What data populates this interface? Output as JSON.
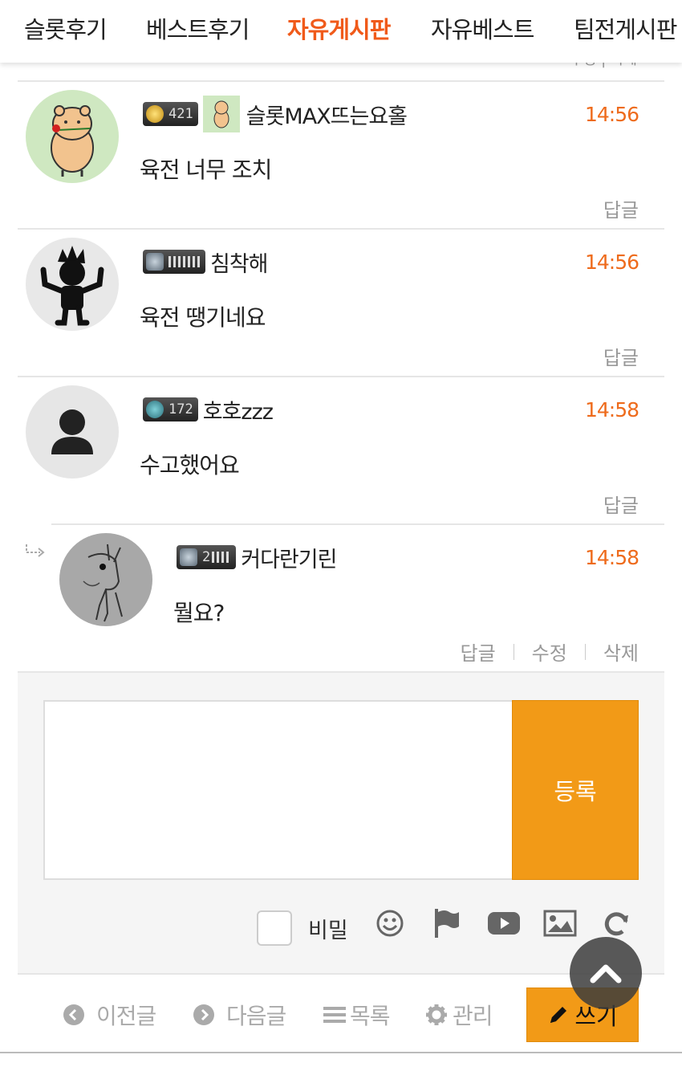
{
  "nav": {
    "tabs": [
      "슬롯후기",
      "베스트후기",
      "자유게시판",
      "자유베스트",
      "팀전게시판"
    ],
    "active_tab": 2,
    "peek_text": "수정 | 삭제"
  },
  "comments": [
    {
      "level": "421",
      "nickname": "슬롯MAX뜨는요홀",
      "time": "14:56",
      "body": "육전 너무 조치",
      "actions": [
        "답글"
      ]
    },
    {
      "level": "",
      "nickname": "침착해",
      "time": "14:56",
      "body": "육전 땡기네요",
      "actions": [
        "답글"
      ]
    },
    {
      "level": "172",
      "nickname": "호호zzz",
      "time": "14:58",
      "body": "수고했어요",
      "actions": [
        "답글"
      ]
    },
    {
      "level": "2",
      "nickname": "커다란기린",
      "time": "14:58",
      "body": "뭘요?",
      "actions": [
        "답글",
        "수정",
        "삭제"
      ],
      "is_reply": true
    }
  ],
  "write": {
    "submit_label": "등록",
    "secret_label": "비밀",
    "textarea_value": "",
    "tools": [
      "smile-icon",
      "flag-icon",
      "youtube-icon",
      "image-icon",
      "refresh-icon"
    ]
  },
  "bottom": {
    "prev_label": "이전글",
    "next_label": "다음글",
    "list_label": "목록",
    "manage_label": "관리",
    "write_label": "쓰기"
  },
  "colors": {
    "accent": "#f29a17",
    "time": "#ee6b1c",
    "active_tab": "#f05a1a"
  }
}
